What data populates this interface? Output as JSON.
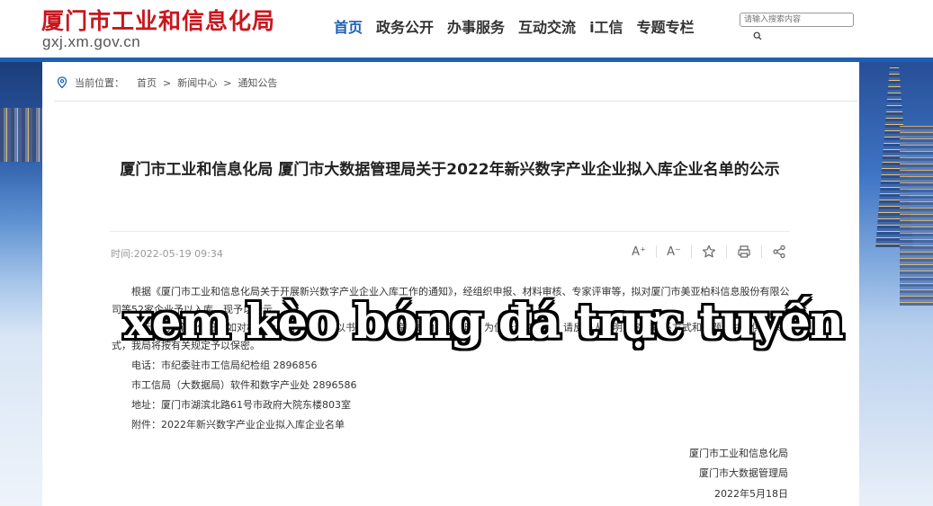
{
  "header": {
    "logo_text": "厦门市工业和信息化局",
    "logo_url": "gxj.xm.gov.cn",
    "nav": [
      "首页",
      "政务公开",
      "办事服务",
      "互动交流",
      "i工信",
      "专题专栏"
    ],
    "search_placeholder": "请输入搜索内容"
  },
  "breadcrumb": {
    "label": "当前位置：",
    "items": [
      "首页",
      "新闻中心",
      "通知公告"
    ]
  },
  "article": {
    "title": "厦门市工业和信息化局 厦门市大数据管理局关于2022年新兴数字产业企业拟入库企业名单的公示",
    "time": "时间:2022-05-19 09:34",
    "para1": "根据《厦门市工业和信息化局关于开展新兴数字产业企业入库工作的通知》，经组织申报、材料审核、专家评审等，拟对厦门市美亚柏科信息股份有限公司等52家企业予以入库，现予以公示。",
    "para2": "公示期为5个工作日，如对相关企业有异议，请以书信、来电等方式向我局反映，为便于调查核实，请反映人写明姓名及联系方式和问题，并提供联系方式，我局将按有关规定予以保密。",
    "contact1": "电话：市纪委驻市工信局纪检组 2896856",
    "contact2": "市工信局（大数据局）软件和数字产业处 2896586",
    "address": "地址：厦门市湖滨北路61号市政府大院东楼803室",
    "attachment": "附件：2022年新兴数字产业企业拟入库企业名单",
    "sign1": "厦门市工业和信息化局",
    "sign2": "厦门市大数据管理局",
    "sign_date": "2022年5月18日"
  },
  "toolbar": {
    "font_larger": "A⁺",
    "font_smaller": "A⁻",
    "icons": [
      "font-increase-icon",
      "font-decrease-icon",
      "star-icon",
      "print-icon",
      "share-icon"
    ]
  },
  "overlay_text": "xem kèo bóng đá trực tuyến",
  "colors": {
    "brand_red": "#c8161d",
    "nav_active": "#1e5fb4"
  }
}
